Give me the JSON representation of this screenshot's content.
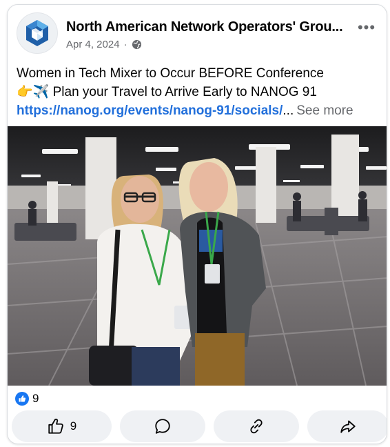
{
  "post": {
    "page_name": "North American Network Operators' Grou...",
    "date": "Apr 4, 2024",
    "separator": "·",
    "audience_icon": "globe-icon",
    "text_line1": "Women in Tech Mixer to Occur BEFORE Conference",
    "text_line2_emoji": "👉✈️",
    "text_line2": " Plan your Travel to Arrive Early  to NANOG 91",
    "link": "https://nanog.org/events/nanog-91/socials/",
    "ellipsis": "...",
    "see_more": "See more",
    "more_icon": "more-options-icon"
  },
  "reactions": {
    "count": "9",
    "icon": "like-icon"
  },
  "actions": {
    "like_count": "9",
    "like_icon": "thumbs-up-icon",
    "comment_icon": "comment-icon",
    "copy_link_icon": "link-icon",
    "share_icon": "share-icon"
  },
  "colors": {
    "link": "#216fdb",
    "like_blue": "#1877f2",
    "button_bg": "#eff1f4",
    "meta_gray": "#65676b"
  }
}
